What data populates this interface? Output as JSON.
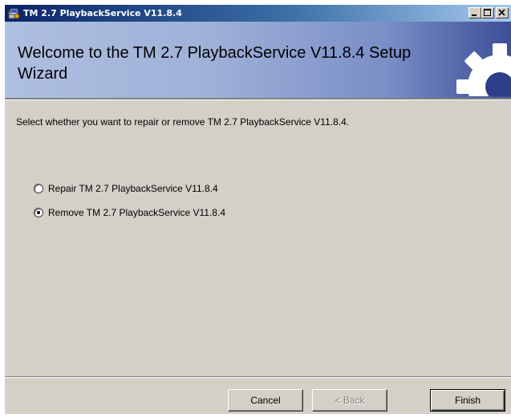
{
  "window": {
    "title": "TM 2.7 PlaybackService V11.8.4",
    "icon": "installer-icon",
    "controls": [
      "minimize-icon",
      "maximize-icon",
      "close-icon"
    ]
  },
  "header": {
    "title": "Welcome to the TM 2.7 PlaybackService V11.8.4 Setup Wizard",
    "graphic": "gear-icon"
  },
  "body": {
    "instruction": "Select whether you want to repair or remove TM 2.7 PlaybackService V11.8.4.",
    "options": [
      {
        "label": "Repair TM 2.7 PlaybackService V11.8.4",
        "selected": false
      },
      {
        "label": "Remove TM 2.7 PlaybackService V11.8.4",
        "selected": true
      }
    ]
  },
  "buttons": {
    "cancel": "Cancel",
    "back": "< Back",
    "finish": "Finish"
  },
  "colors": {
    "titlebar_start": "#0a246a",
    "titlebar_end": "#a6caf0",
    "banner_start": "#aebfe0",
    "banner_end": "#3c4d96",
    "face": "#d4d0c8"
  }
}
